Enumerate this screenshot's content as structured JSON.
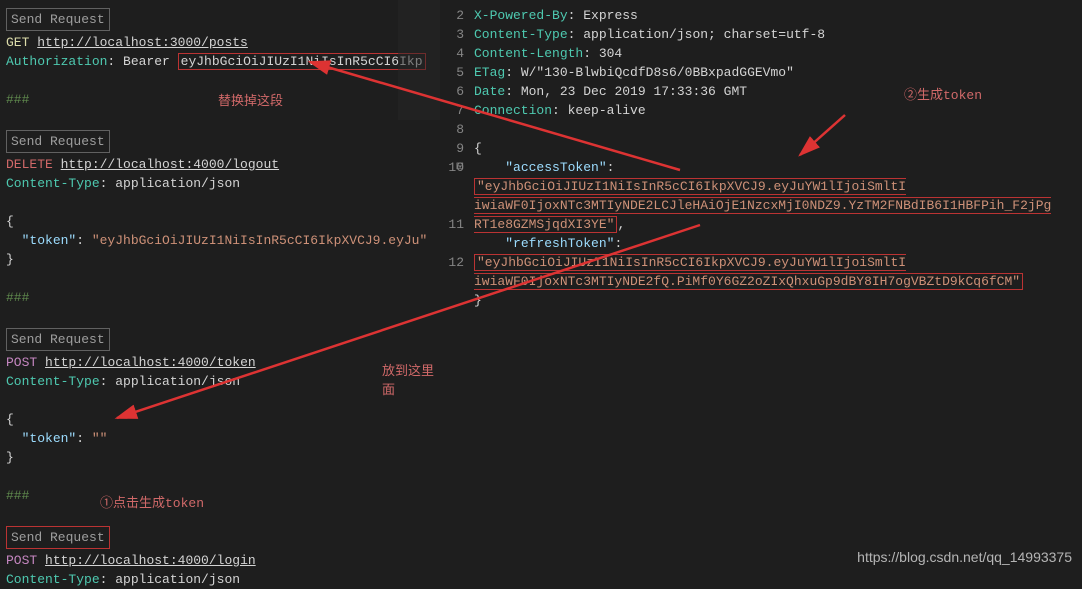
{
  "left": {
    "r1": {
      "send": "Send Request",
      "method": "GET",
      "url": "http://localhost:3000/posts",
      "hdr_key": "Authorization",
      "hdr_val_pre": "Bearer",
      "hdr_val_token": "eyJhbGciOiJIUzI1NiIsInR5cCI6Ikp"
    },
    "sep": "###",
    "r2": {
      "send": "Send Request",
      "method": "DELETE",
      "url": "http://localhost:4000/logout",
      "hdr_key": "Content-Type",
      "hdr_val": "application/json",
      "body_key": "\"token\"",
      "body_val": "\"eyJhbGciOiJIUzI1NiIsInR5cCI6IkpXVCJ9.eyJu\""
    },
    "r3": {
      "send": "Send Request",
      "method": "POST",
      "url": "http://localhost:4000/token",
      "hdr_key": "Content-Type",
      "hdr_val": "application/json",
      "body_key": "\"token\"",
      "body_val": "\"\""
    },
    "r4": {
      "send": "Send Request",
      "method": "POST",
      "url": "http://localhost:4000/login",
      "hdr_key": "Content-Type",
      "hdr_val": "application/json"
    }
  },
  "right": {
    "lines": {
      "2": {
        "k": "X-Powered-By",
        "v": "Express"
      },
      "3": {
        "k": "Content-Type",
        "v": "application/json; charset=utf-8"
      },
      "4": {
        "k": "Content-Length",
        "v": "304"
      },
      "5": {
        "k": "ETag",
        "v": "W/\"130-BlwbiQcdfD8s6/0BBxpadGGEVmo\""
      },
      "6": {
        "k": "Date",
        "v": "Mon, 23 Dec 2019 17:33:36 GMT"
      },
      "7": {
        "k": "Connection",
        "v": "keep-alive"
      }
    },
    "brace_open": "{",
    "access_key": "\"accessToken\"",
    "access_val": "\"eyJhbGciOiJIUzI1NiIsInR5cCI6IkpXVCJ9.eyJuYW1lIjoiSmltI iwiaWF0IjoxNTc3MTIyNDE2LCJleHAiOjE1NzcxMjI0NDZ9.YzTM2FNBdIB6I1HBFPih_F2jPg RT1e8GZMSjqdXI3YE\"",
    "refresh_key": "\"refreshToken\"",
    "refresh_val": "\"eyJhbGciOiJIUzI1NiIsInR5cCI6IkpXVCJ9.eyJuYW1lIjoiSmltI iwiaWF0IjoxNTc3MTIyNDE2fQ.PiMf0Y6GZ2oZIxQhxuGp9dBY8IH7ogVBZtD9kCq6fCM\"",
    "brace_close": "}"
  },
  "annotations": {
    "replace": "替换掉这段",
    "gen_token": "②生成token",
    "put_here": "放到这里面",
    "click_gen": "①点击生成token"
  },
  "watermark": "https://blog.csdn.net/qq_14993375",
  "gutter": [
    "2",
    "3",
    "4",
    "5",
    "6",
    "7",
    "8",
    "9",
    "10",
    "",
    "",
    "11",
    "",
    "12"
  ]
}
